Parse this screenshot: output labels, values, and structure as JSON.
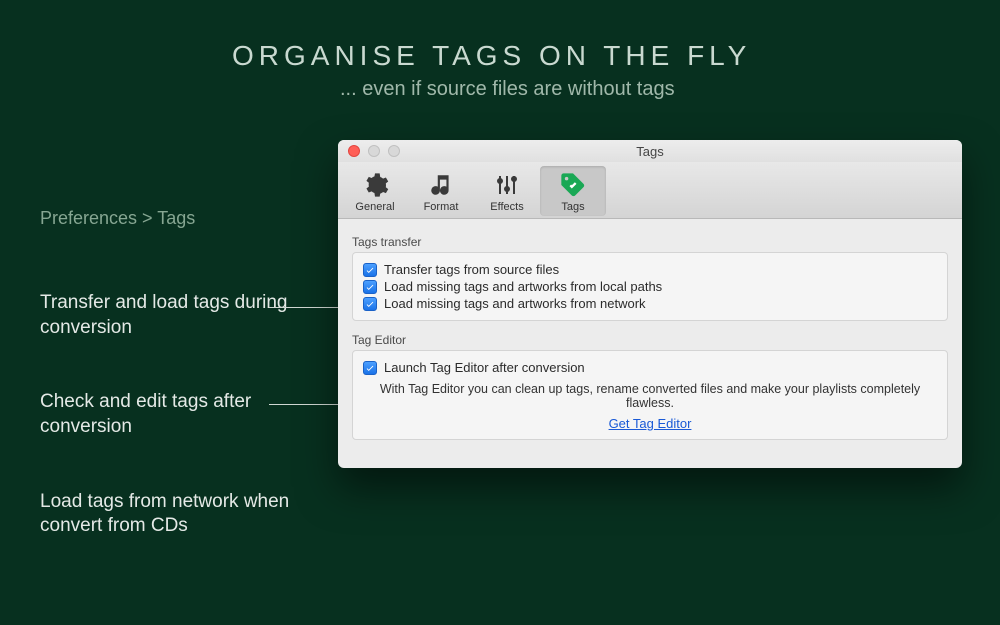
{
  "headline": "ORGANISE  TAGS  ON  THE  FLY",
  "subhead": "... even if source files are without tags",
  "breadcrumb": "Preferences > Tags",
  "callouts": [
    "Transfer and load tags during conversion",
    "Check and edit tags after conversion",
    "Load tags from network when convert from CDs"
  ],
  "window": {
    "title": "Tags",
    "tabs": [
      {
        "label": "General"
      },
      {
        "label": "Format"
      },
      {
        "label": "Effects"
      },
      {
        "label": "Tags"
      }
    ],
    "active_tab": 3,
    "groups": {
      "transfer": {
        "label": "Tags transfer",
        "items": [
          {
            "checked": true,
            "label": "Transfer tags from source files"
          },
          {
            "checked": true,
            "label": "Load missing tags and artworks from local paths"
          },
          {
            "checked": true,
            "label": "Load missing tags and artworks from network"
          }
        ]
      },
      "editor": {
        "label": "Tag Editor",
        "launch": {
          "checked": true,
          "label": "Launch Tag Editor after conversion"
        },
        "description": "With Tag Editor you can clean up tags, rename converted files and make your playlists completely flawless.",
        "link": "Get Tag Editor"
      }
    }
  }
}
